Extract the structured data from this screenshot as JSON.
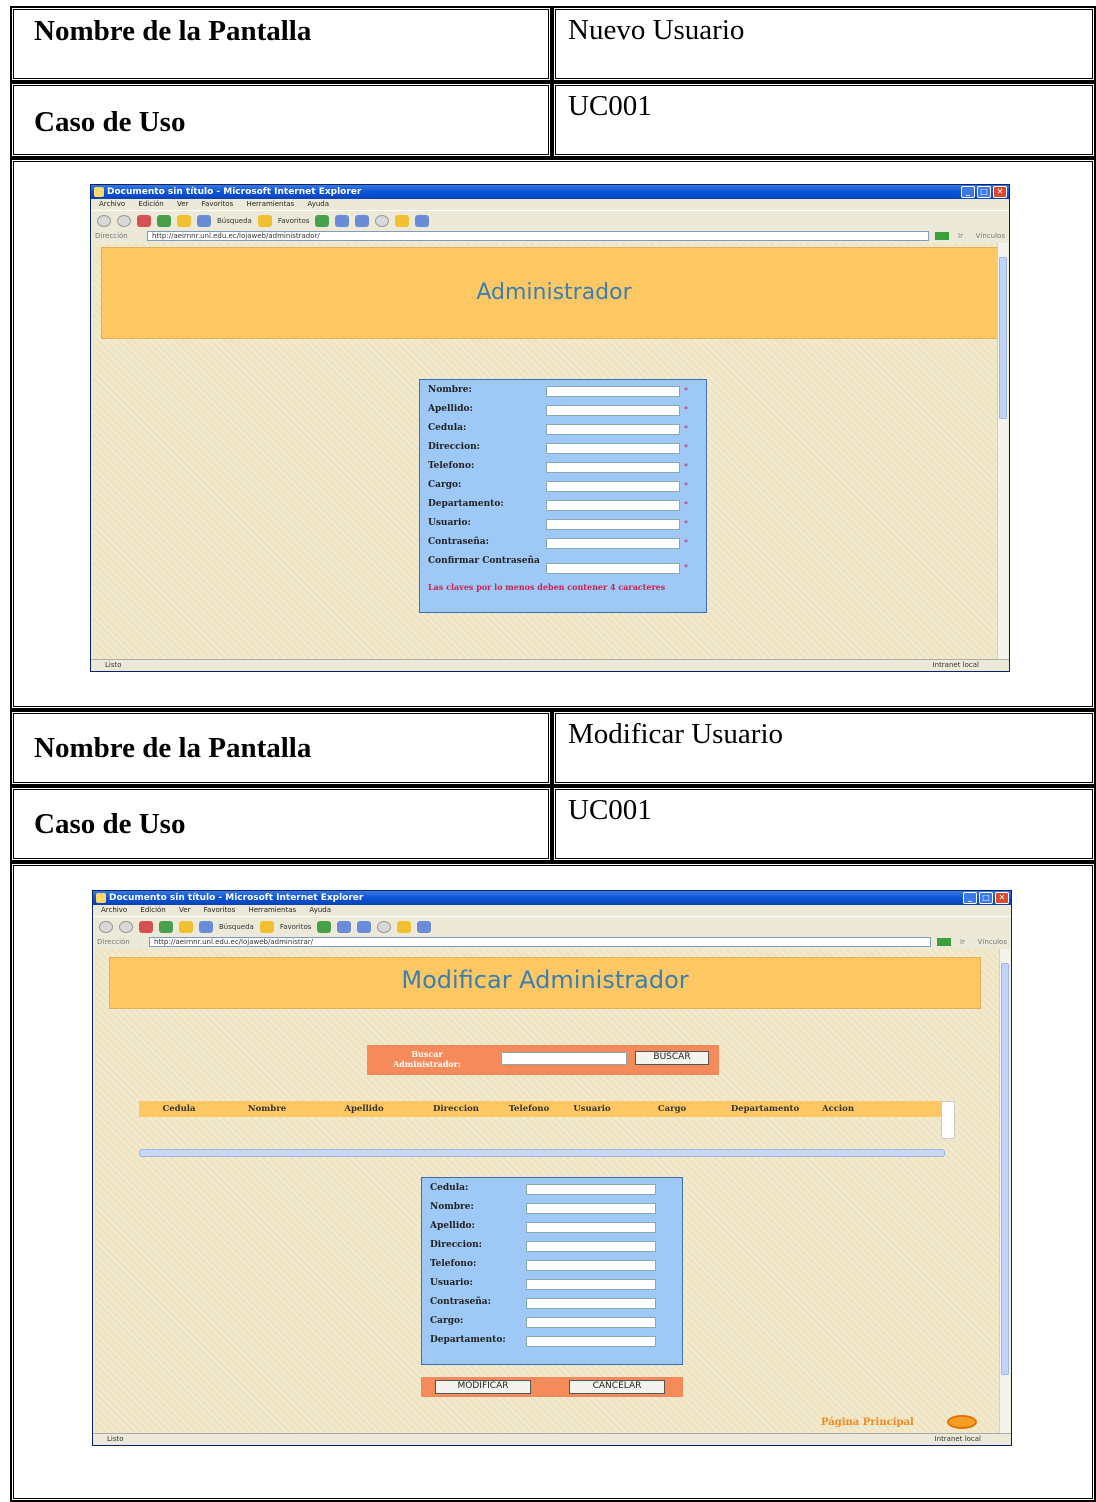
{
  "block1": {
    "label_screen": "Nombre de la Pantalla",
    "screen_name": "Nuevo Usuario",
    "label_usecase": "Caso de Uso",
    "usecase": "UC001",
    "browser": {
      "title": "Documento sin título - Microsoft Internet Explorer",
      "menu": [
        "Archivo",
        "Edición",
        "Ver",
        "Favoritos",
        "Herramientas",
        "Ayuda"
      ],
      "search_btn": "Búsqueda",
      "favorites_btn": "Favoritos",
      "address_label": "Dirección",
      "url": "http://aeirnnr.unl.edu.ec/lojaweb/administrador/",
      "go_label": "Ir",
      "links_label": "Vínculos",
      "status": "Listo",
      "zone": "Intranet local"
    },
    "page_title": "Administrador",
    "fields": [
      "Nombre:",
      "Apellido:",
      "Cedula:",
      "Direccion:",
      "Telefono:",
      "Cargo:",
      "Departamento:",
      "Usuario:",
      "Contraseña:",
      "Confirmar Contraseña"
    ],
    "required_mark": "*",
    "note": "Las claves por lo menos deben contener 4 caracteres"
  },
  "block2": {
    "label_screen": "Nombre de la Pantalla",
    "screen_name": "Modificar Usuario",
    "label_usecase": "Caso de Uso",
    "usecase": "UC001",
    "browser": {
      "title": "Documento sin título - Microsoft Internet Explorer",
      "menu": [
        "Archivo",
        "Edición",
        "Ver",
        "Favoritos",
        "Herramientas",
        "Ayuda"
      ],
      "search_btn": "Búsqueda",
      "favorites_btn": "Favoritos",
      "address_label": "Dirección",
      "url": "http://aeirnnr.unl.edu.ec/lojaweb/administrar/",
      "go_label": "Ir",
      "links_label": "Vínculos",
      "status": "Listo",
      "zone": "Intranet local"
    },
    "page_title": "Modificar Administrador",
    "search_label": "Buscar Administrador:",
    "search_button": "BUSCAR",
    "table_columns": [
      "Cedula",
      "Nombre",
      "Apellido",
      "Direccion",
      "Telefono",
      "Usuario",
      "Cargo",
      "Departamento",
      "Accion"
    ],
    "fields": [
      "Cedula:",
      "Nombre:",
      "Apellido:",
      "Direccion:",
      "Telefono:",
      "Usuario:",
      "Contraseña:",
      "Cargo:",
      "Departamento:"
    ],
    "modify_button": "MODIFICAR",
    "cancel_button": "CANCELAR",
    "home_link": "Página Principal"
  }
}
